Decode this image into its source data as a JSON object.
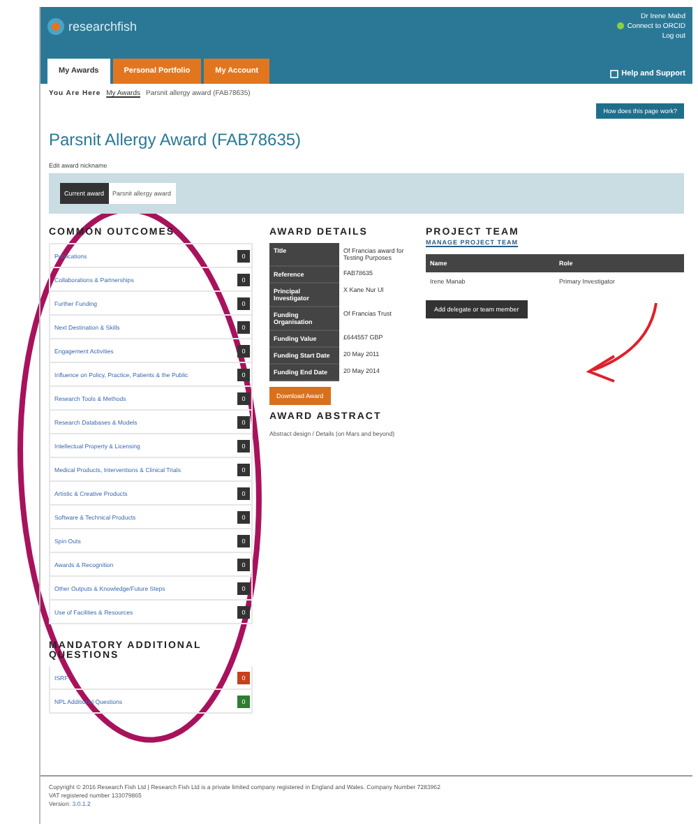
{
  "header": {
    "logo": "researchfish",
    "user": "Dr Irene Mabd",
    "orcid": "Connect to ORCID",
    "logout": "Log out",
    "help": "Help and Support"
  },
  "tabs": [
    {
      "label": "My Awards",
      "selected": true
    },
    {
      "label": "Personal Portfolio",
      "selected": false
    },
    {
      "label": "My Account",
      "selected": false
    }
  ],
  "breadcrumb": {
    "label": "You Are Here",
    "link": "My Awards",
    "current": "Parsnit allergy award (FAB78635)"
  },
  "help_button": "How does this page work?",
  "title": "Parsnit Allergy Award (FAB78635)",
  "nickname_link": "Edit award nickname",
  "award_picker": {
    "label": "Current award",
    "value": "Parsnit allergy award"
  },
  "common_outcomes": {
    "heading": "COMMON OUTCOMES",
    "items": [
      {
        "label": "Publications",
        "count": "0"
      },
      {
        "label": "Collaborations & Partnerships",
        "count": "0"
      },
      {
        "label": "Further Funding",
        "count": "0"
      },
      {
        "label": "Next Destination & Skills",
        "count": "0"
      },
      {
        "label": "Engagement Activities",
        "count": "0"
      },
      {
        "label": "Influence on Policy, Practice, Patients & the Public",
        "count": "0"
      },
      {
        "label": "Research Tools & Methods",
        "count": "0"
      },
      {
        "label": "Research Databases & Models",
        "count": "0"
      },
      {
        "label": "Intellectual Property & Licensing",
        "count": "0"
      },
      {
        "label": "Medical Products, Interventions & Clinical Trials",
        "count": "0"
      },
      {
        "label": "Artistic & Creative Products",
        "count": "0"
      },
      {
        "label": "Software & Technical Products",
        "count": "0"
      },
      {
        "label": "Spin Outs",
        "count": "0"
      },
      {
        "label": "Awards & Recognition",
        "count": "0"
      },
      {
        "label": "Other Outputs & Knowledge/Future Steps",
        "count": "0"
      },
      {
        "label": "Use of Facilities & Resources",
        "count": "0"
      }
    ]
  },
  "mandatory": {
    "heading": "MANDATORY ADDITIONAL QUESTIONS",
    "items": [
      {
        "label": "ISRF",
        "count": "0",
        "color": "#c8401c"
      },
      {
        "label": "NPL Additional Questions",
        "count": "0",
        "color": "#2e7d32"
      }
    ]
  },
  "award_details": {
    "heading": "AWARD DETAILS",
    "rows": [
      {
        "key": "Title",
        "value": "Of Francias award for Testing Purposes"
      },
      {
        "key": "Reference",
        "value": "FAB78635"
      },
      {
        "key": "Principal Investigator",
        "value": "X Kane Nur Ul"
      },
      {
        "key": "Funding Organisation",
        "value": "Of Francias Trust"
      },
      {
        "key": "Funding Value",
        "value": "£644557 GBP"
      },
      {
        "key": "Funding Start Date",
        "value": "20 May 2011"
      },
      {
        "key": "Funding End Date",
        "value": "20 May 2014"
      }
    ],
    "download": "Download Award"
  },
  "abstract": {
    "heading": "AWARD ABSTRACT",
    "text": "Abstract design / Details (on Mars and beyond)"
  },
  "team": {
    "heading": "PROJECT TEAM",
    "manage": "MANAGE PROJECT TEAM",
    "columns": [
      "Name",
      "Role"
    ],
    "rows": [
      [
        "Irene Manab",
        "Primary Investigator"
      ]
    ],
    "add": "Add delegate or team member"
  },
  "footer": {
    "lines": [
      "Copyright © 2016 Research Fish Ltd | Research Fish Ltd is a private limited company registered in England and Wales. Company Number 7283962",
      "VAT registered number 133079865"
    ],
    "version_label": "Version:",
    "version": "3.0.1.2"
  }
}
